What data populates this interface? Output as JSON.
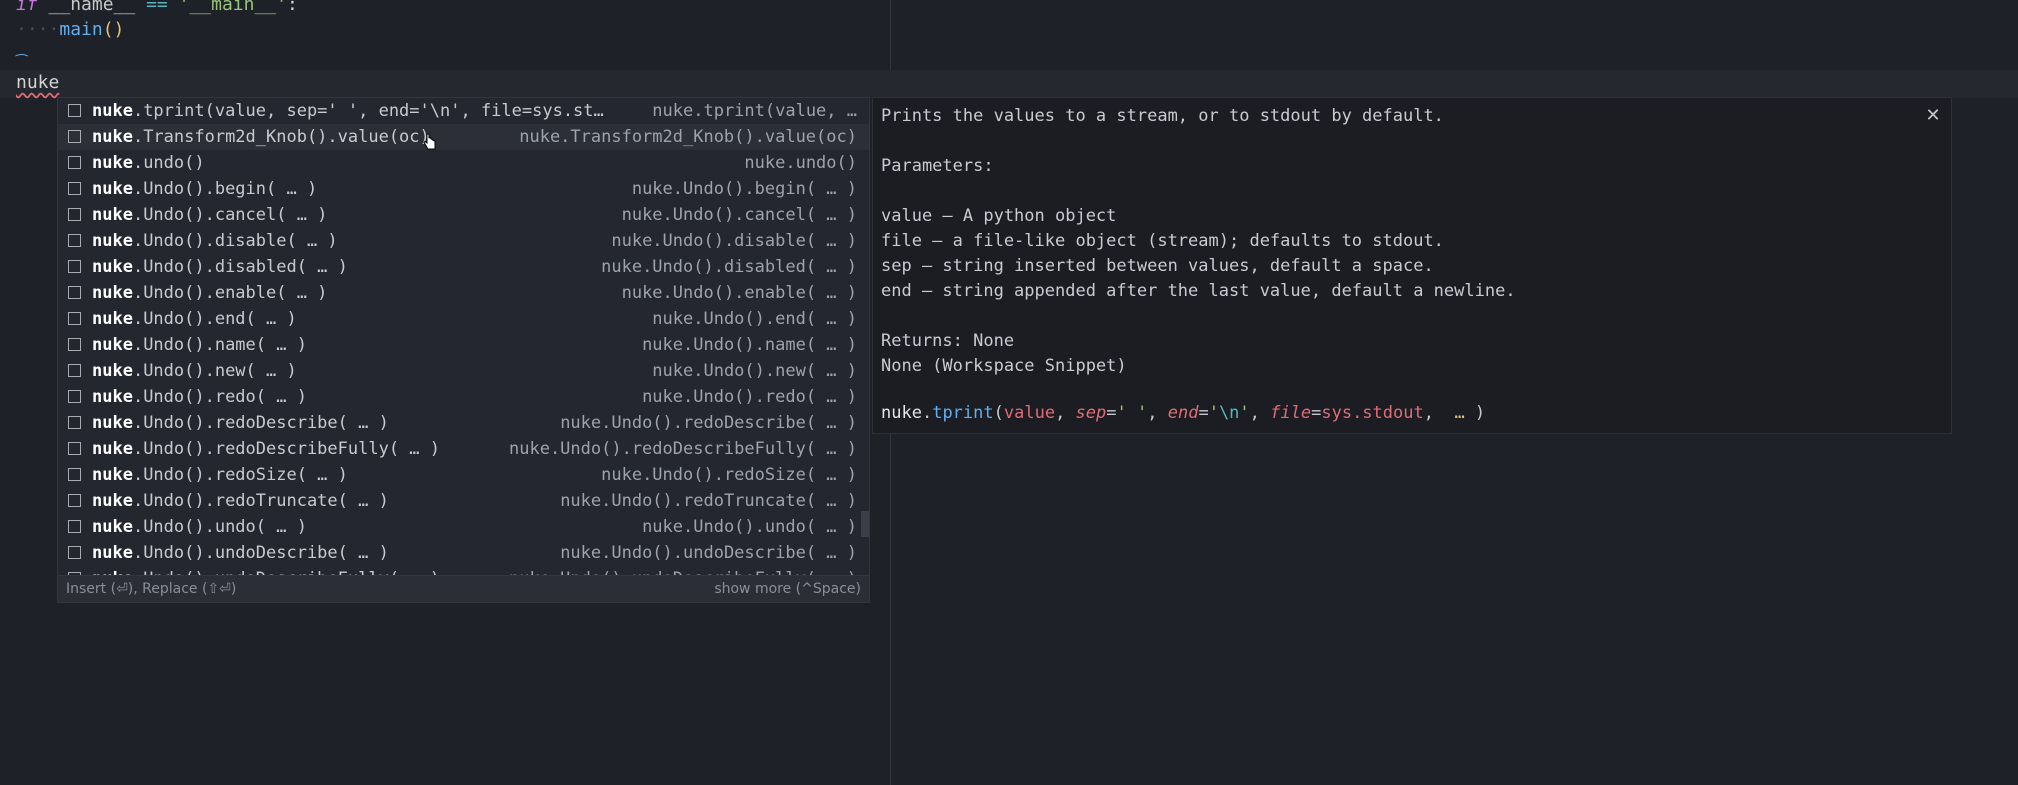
{
  "code": {
    "line1": {
      "kw": "if",
      "name": "__name__",
      "op": "==",
      "str": "'__main__'",
      "colon": ":"
    },
    "line2": {
      "indent": "····",
      "call": "main",
      "parens": "()"
    },
    "typed": "nuke",
    "caret_glyph": "⁀"
  },
  "suggest": {
    "items": [
      {
        "label_bold": "nuke",
        "label_rest": ".tprint(value, sep=' ', end='\\n', file=sys.st…",
        "detail": "nuke.tprint(value, …"
      },
      {
        "label_bold": "nuke",
        "label_rest": ".Transform2d_Knob().value(oc)",
        "detail": "nuke.Transform2d_Knob().value(oc)"
      },
      {
        "label_bold": "nuke",
        "label_rest": ".undo()",
        "detail": "nuke.undo()"
      },
      {
        "label_bold": "nuke",
        "label_rest": ".Undo().begin( … )",
        "detail": "nuke.Undo().begin( … )"
      },
      {
        "label_bold": "nuke",
        "label_rest": ".Undo().cancel( … )",
        "detail": "nuke.Undo().cancel( … )"
      },
      {
        "label_bold": "nuke",
        "label_rest": ".Undo().disable( … )",
        "detail": "nuke.Undo().disable( … )"
      },
      {
        "label_bold": "nuke",
        "label_rest": ".Undo().disabled( … )",
        "detail": "nuke.Undo().disabled( … )"
      },
      {
        "label_bold": "nuke",
        "label_rest": ".Undo().enable( … )",
        "detail": "nuke.Undo().enable( … )"
      },
      {
        "label_bold": "nuke",
        "label_rest": ".Undo().end( … )",
        "detail": "nuke.Undo().end( … )"
      },
      {
        "label_bold": "nuke",
        "label_rest": ".Undo().name( … )",
        "detail": "nuke.Undo().name( … )"
      },
      {
        "label_bold": "nuke",
        "label_rest": ".Undo().new( … )",
        "detail": "nuke.Undo().new( … )"
      },
      {
        "label_bold": "nuke",
        "label_rest": ".Undo().redo( … )",
        "detail": "nuke.Undo().redo( … )"
      },
      {
        "label_bold": "nuke",
        "label_rest": ".Undo().redoDescribe( … )",
        "detail": "nuke.Undo().redoDescribe( … )"
      },
      {
        "label_bold": "nuke",
        "label_rest": ".Undo().redoDescribeFully( … )",
        "detail": "nuke.Undo().redoDescribeFully( … )"
      },
      {
        "label_bold": "nuke",
        "label_rest": ".Undo().redoSize( … )",
        "detail": "nuke.Undo().redoSize( … )"
      },
      {
        "label_bold": "nuke",
        "label_rest": ".Undo().redoTruncate( … )",
        "detail": "nuke.Undo().redoTruncate( … )"
      },
      {
        "label_bold": "nuke",
        "label_rest": ".Undo().undo( … )",
        "detail": "nuke.Undo().undo( … )"
      },
      {
        "label_bold": "nuke",
        "label_rest": ".Undo().undoDescribe( … )",
        "detail": "nuke.Undo().undoDescribe( … )"
      },
      {
        "label_bold": "nuke",
        "label_rest": ".Undo().undoDescribeFully( … )",
        "detail": "nuke.Undo().undoDescribeFully( … )"
      }
    ],
    "footer_left": "Insert (⏎), Replace (⇧⏎)",
    "footer_right": "show more (^Space)"
  },
  "docs": {
    "summary": "Prints the values to a stream, or to stdout by default.",
    "params_heading": "Parameters:",
    "params": [
      "value – A python object",
      "file – a file-like object (stream); defaults to stdout.",
      "sep – string inserted between values, default a space.",
      "end – string appended after the last value, default a newline."
    ],
    "returns": "Returns: None",
    "source": "None (Workspace Snippet)",
    "signature": {
      "mod": "nuke",
      "dot": ".",
      "fn": "tprint",
      "open": "(",
      "p1": "value",
      "c1": ", ",
      "k2": "sep",
      "eq2": "=",
      "v2": "' '",
      "c2": ", ",
      "k3": "end",
      "eq3": "=",
      "v3q1": "'",
      "v3esc": "\\n",
      "v3q2": "'",
      "c3": ", ",
      "k4": "file",
      "eq4": "=",
      "v4": "sys.stdout",
      "c4": ", ",
      "dots": " … ",
      "close": ")"
    },
    "close_glyph": "✕"
  },
  "colors": {
    "background": "#1f2128",
    "function": "#61afef",
    "keyword": "#c678dd",
    "string": "#98c379",
    "parameter": "#e06c75"
  }
}
